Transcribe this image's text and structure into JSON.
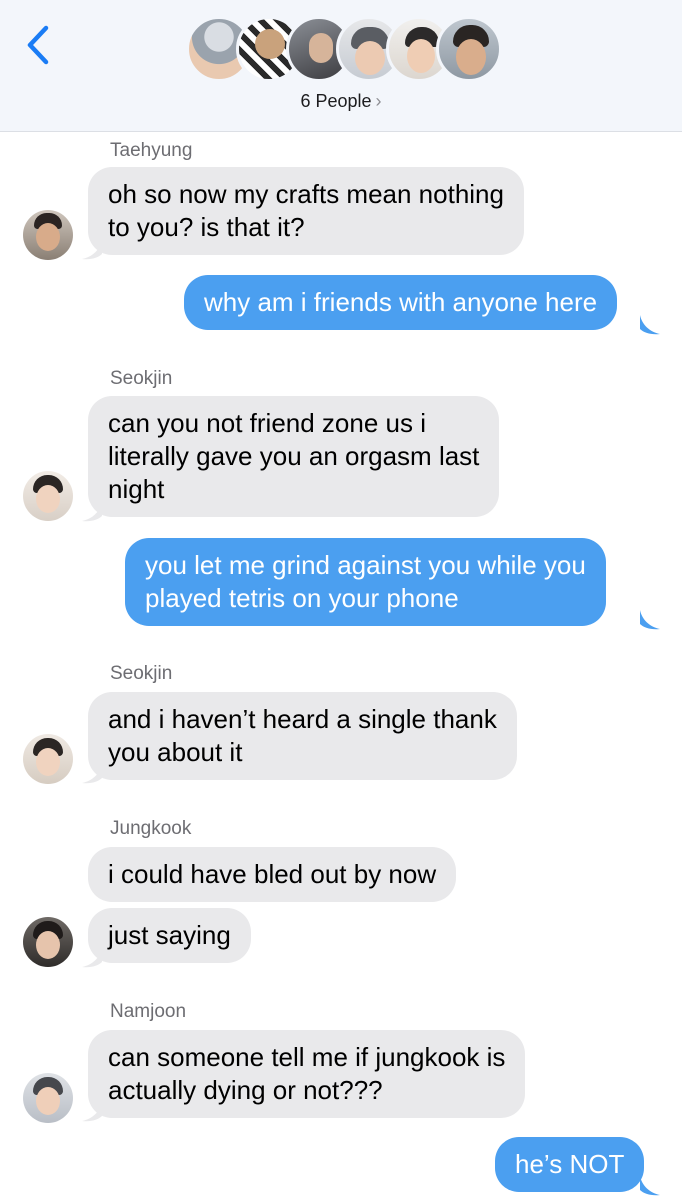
{
  "header": {
    "people_label": "6 People",
    "back_icon": "chevron-left-icon",
    "chevron_icon": "chevron-right-icon",
    "accent": "#1a7cf5"
  },
  "colors": {
    "incoming_bubble": "#e9e9eb",
    "outgoing_bubble": "#4b9ff0",
    "sender_name": "#6d6d72"
  },
  "messages": [
    {
      "sender": "Taehyung",
      "text": "oh so now my crafts mean nothing\nto you? is that it?",
      "direction": "in"
    },
    {
      "text": "why am i friends with anyone here",
      "direction": "out"
    },
    {
      "sender": "Seokjin",
      "text": "can you not friend zone us i\nliterally gave you an orgasm last\nnight",
      "direction": "in"
    },
    {
      "text": "you let me grind against you while you\nplayed tetris on your phone",
      "direction": "out"
    },
    {
      "sender": "Seokjin",
      "text": "and i haven’t heard a single thank\nyou about it",
      "direction": "in"
    },
    {
      "sender": "Jungkook",
      "text": "i could have bled out by now",
      "direction": "in"
    },
    {
      "text": "just saying",
      "direction": "in"
    },
    {
      "sender": "Namjoon",
      "text": "can someone tell me if jungkook is\nactually dying or not???",
      "direction": "in"
    },
    {
      "text": "he’s NOT",
      "direction": "out"
    }
  ]
}
